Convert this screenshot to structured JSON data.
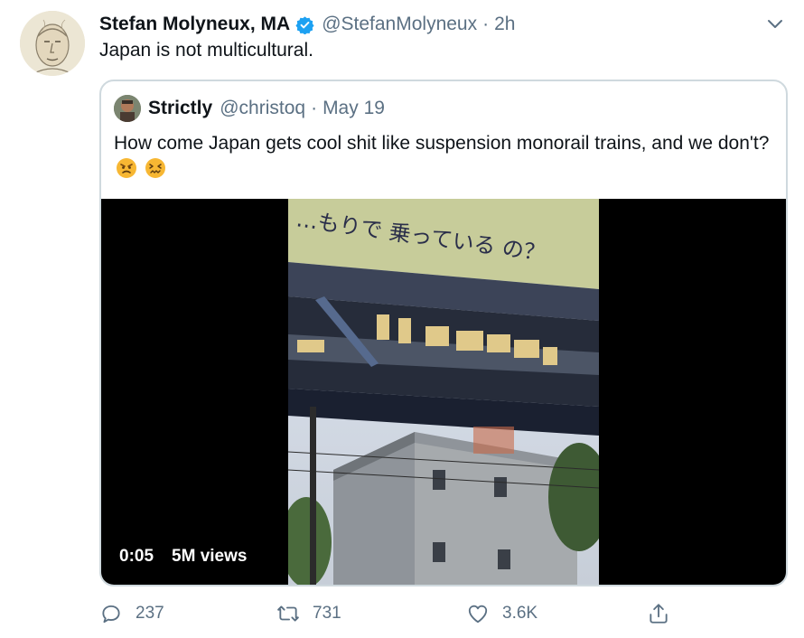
{
  "tweet": {
    "author_name": "Stefan Molyneux, MA",
    "handle": "@StefanMolyneux",
    "separator": "·",
    "time": "2h",
    "text": "Japan is not multicultural.",
    "avatar_icon": "portrait-avatar",
    "verified_icon": "verified-badge-icon",
    "menu_icon": "chevron-down-icon"
  },
  "quoted": {
    "author_name": "Strictly",
    "handle": "@christoq",
    "separator": "·",
    "time": "May 19",
    "text": "How come Japan gets cool shit like suspension monorail trains, and we don't?",
    "emojis": [
      "angry-face-emoji",
      "confounded-face-emoji"
    ],
    "video": {
      "duration": "0:05",
      "views": "5M views",
      "sign_text": "…もりで 乗っている の？"
    }
  },
  "actions": {
    "reply_count": "237",
    "retweet_count": "731",
    "like_count": "3.6K"
  },
  "colors": {
    "text": "#0f1419",
    "secondary": "#5b7083",
    "verified": "#1da1f2",
    "border": "#cfd9de"
  }
}
